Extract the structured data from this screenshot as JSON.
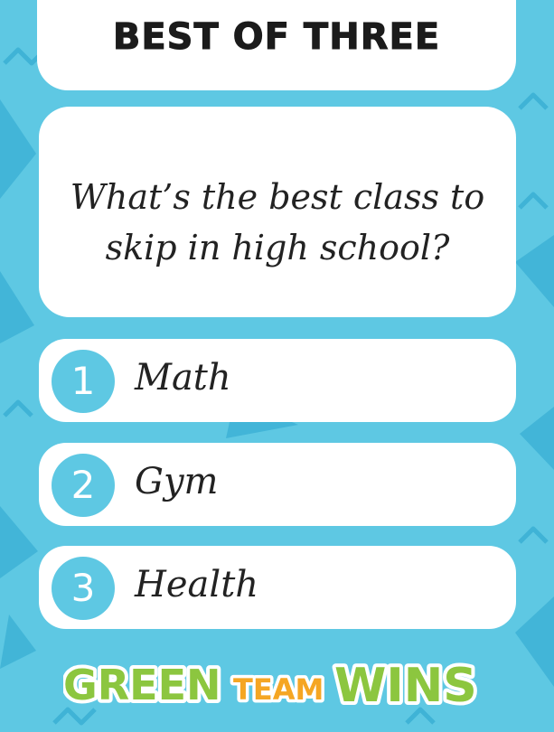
{
  "header": {
    "title": "BEST OF THREE"
  },
  "question": {
    "text": "What’s the best class to skip in high school?"
  },
  "options": [
    {
      "number": "1",
      "label": "Math"
    },
    {
      "number": "2",
      "label": "Gym"
    },
    {
      "number": "3",
      "label": "Health"
    }
  ],
  "logo": {
    "word1": "GREEN",
    "word2": "TEAM",
    "word3": "WINS"
  },
  "colors": {
    "background": "#5ec8e3",
    "accent_green": "#8cc63f",
    "accent_orange": "#f5a623",
    "card": "#ffffff"
  }
}
